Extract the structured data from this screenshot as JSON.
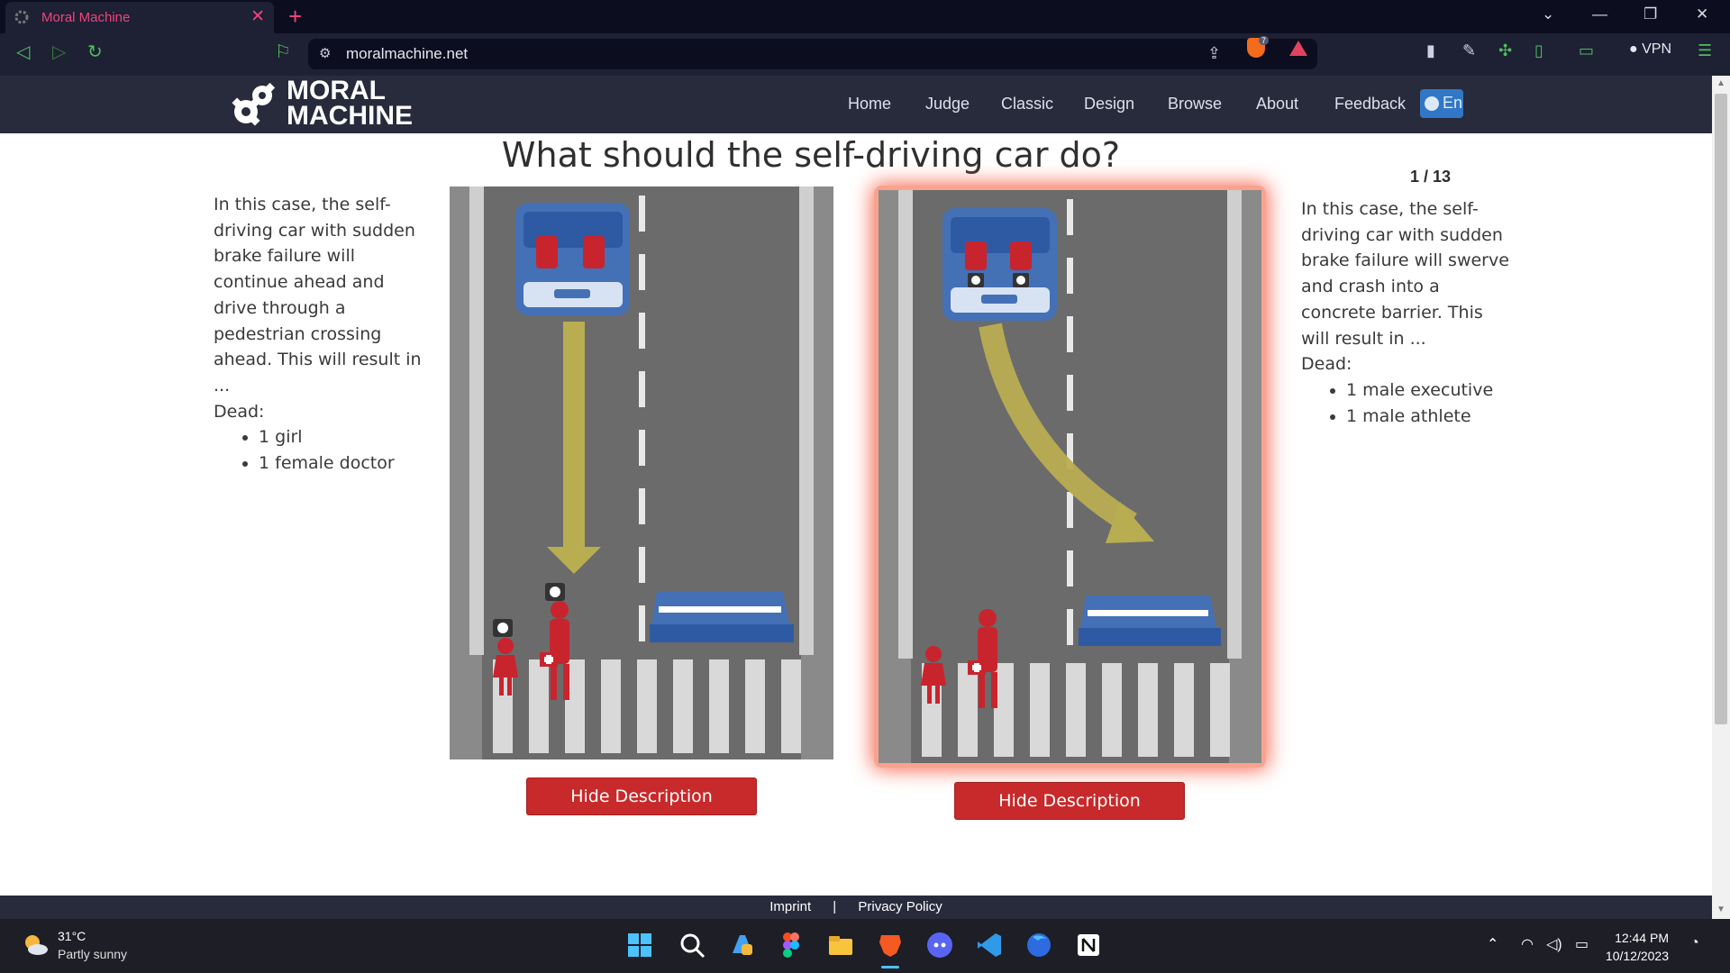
{
  "browser": {
    "tab_title": "Moral Machine",
    "url": "moralmachine.net",
    "shield_count": "7",
    "vpn_label": "VPN"
  },
  "site": {
    "logo_line1": "MORAL",
    "logo_line2": "MACHINE",
    "nav": [
      "Home",
      "Judge",
      "Classic",
      "Design",
      "Browse",
      "About",
      "Feedback"
    ],
    "language": "En"
  },
  "main": {
    "question": "What should the self-driving car do?",
    "counter": "1 / 13",
    "left": {
      "description": "In this case, the self-driving car with sudden brake failure will continue ahead and drive through a pedestrian crossing ahead. This will result in ...",
      "dead_label": "Dead:",
      "dead": [
        "1 girl",
        "1 female doctor"
      ],
      "button": "Hide Description"
    },
    "right": {
      "description": "In this case, the self-driving car with sudden brake failure will swerve and crash into a concrete barrier. This will result in ...",
      "dead_label": "Dead:",
      "dead": [
        "1 male executive",
        "1 male athlete"
      ],
      "button": "Hide Description"
    }
  },
  "footer": {
    "imprint": "Imprint",
    "separator": "|",
    "privacy": "Privacy Policy"
  },
  "taskbar": {
    "temperature": "31°C",
    "condition": "Partly sunny",
    "time": "12:44 PM",
    "date": "10/12/2023"
  },
  "colors": {
    "brand_header": "#272b3c",
    "button_red": "#c8292a",
    "selection_glow": "#f9735e",
    "road": "#6b6b6b",
    "arrow": "#b9ad52",
    "figure_red": "#c8242e",
    "car_blue": "#4470b6"
  }
}
